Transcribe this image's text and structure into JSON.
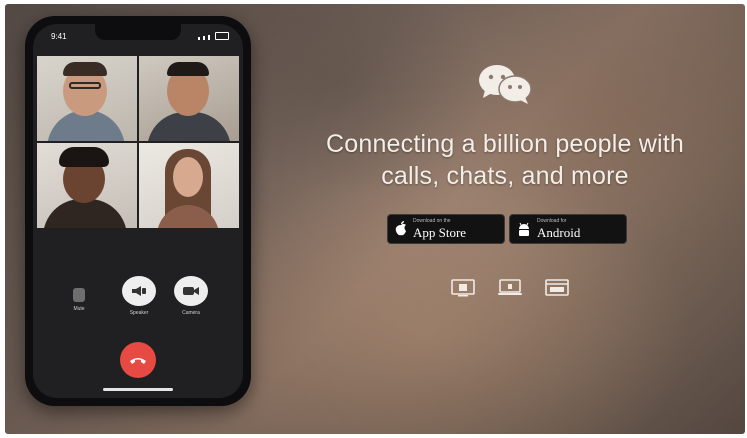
{
  "phone": {
    "status_time": "9:41",
    "call_controls": [
      {
        "label": "Mute",
        "icon": "mute-icon"
      },
      {
        "label": "Speaker",
        "icon": "speaker-icon"
      },
      {
        "label": "Camera",
        "icon": "camera-icon"
      }
    ],
    "end_call_icon": "phone-hangup-icon",
    "end_call_color": "#e64a43"
  },
  "hero": {
    "logo_icon": "wechat-logo-icon",
    "headline_line1": "Connecting a billion people with",
    "headline_line2": "calls, chats, and more"
  },
  "downloads": {
    "appstore": {
      "small": "Download on the",
      "big": "App Store",
      "icon": "apple-icon"
    },
    "android": {
      "small": "Download for",
      "big": "Android",
      "icon": "android-icon"
    }
  },
  "platforms": [
    {
      "name": "windows-icon"
    },
    {
      "name": "mac-icon"
    },
    {
      "name": "web-icon"
    }
  ]
}
